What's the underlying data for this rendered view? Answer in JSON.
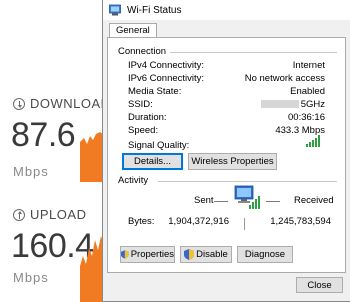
{
  "speedtest": {
    "download": {
      "label": "DOWNLOAD",
      "value": "87.6",
      "unit": "Mbps",
      "fill_fraction": 0.6
    },
    "upload": {
      "label": "UPLOAD",
      "value": "160.4",
      "unit": "Mbps",
      "fill_fraction": 0.85
    },
    "accent_color": "#f07b23"
  },
  "dialog": {
    "title": "Wi-Fi Status",
    "tab": "General",
    "connection": {
      "title": "Connection",
      "rows": [
        {
          "label": "IPv4 Connectivity:",
          "value": "Internet"
        },
        {
          "label": "IPv6 Connectivity:",
          "value": "No network access"
        },
        {
          "label": "Media State:",
          "value": "Enabled"
        },
        {
          "label": "SSID:",
          "value": "5GHz"
        },
        {
          "label": "Duration:",
          "value": "00:36:16"
        },
        {
          "label": "Speed:",
          "value": "433.3 Mbps"
        }
      ],
      "signal_quality_label": "Signal Quality:",
      "signal_bars": 5
    },
    "buttons": {
      "details": "Details...",
      "wireless_properties": "Wireless Properties",
      "properties": "Properties",
      "disable": "Disable",
      "diagnose": "Diagnose",
      "close": "Close"
    },
    "activity": {
      "title": "Activity",
      "sent_label": "Sent",
      "received_label": "Received",
      "bytes_label": "Bytes:",
      "bytes_sent": "1,904,372,916",
      "bytes_received": "1,245,783,594"
    }
  }
}
